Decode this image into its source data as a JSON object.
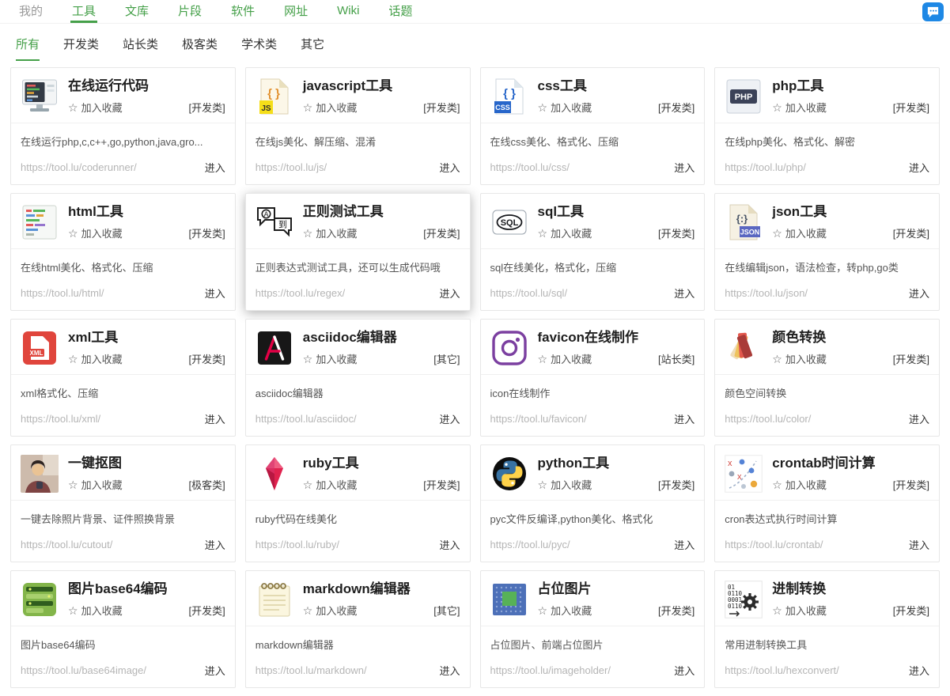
{
  "colors": {
    "accent": "#45a049",
    "chat_icon": "#1e88e5"
  },
  "labels": {
    "favorite": "加入收藏",
    "enter": "进入",
    "star_glyph": "☆"
  },
  "nav": {
    "items": [
      {
        "key": "my",
        "label": "我的",
        "muted": true
      },
      {
        "key": "tools",
        "label": "工具",
        "active": true
      },
      {
        "key": "docs",
        "label": "文库"
      },
      {
        "key": "snippets",
        "label": "片段"
      },
      {
        "key": "software",
        "label": "软件"
      },
      {
        "key": "urls",
        "label": "网址"
      },
      {
        "key": "wiki",
        "label": "Wiki"
      },
      {
        "key": "topics",
        "label": "话题"
      }
    ]
  },
  "tabs": [
    {
      "key": "all",
      "label": "所有",
      "active": true
    },
    {
      "key": "dev",
      "label": "开发类"
    },
    {
      "key": "webmaster",
      "label": "站长类"
    },
    {
      "key": "geek",
      "label": "极客类"
    },
    {
      "key": "academic",
      "label": "学术类"
    },
    {
      "key": "other",
      "label": "其它"
    }
  ],
  "cards": [
    {
      "key": "coderunner",
      "title": "在线运行代码",
      "category": "[开发类]",
      "desc": "在线运行php,c,c++,go,python,java,gro...",
      "url": "https://tool.lu/coderunner/",
      "icon": "coderunner"
    },
    {
      "key": "js",
      "title": "javascript工具",
      "category": "[开发类]",
      "desc": "在线js美化、解压缩、混淆",
      "url": "https://tool.lu/js/",
      "icon": "js",
      "icon_text": "JS"
    },
    {
      "key": "css",
      "title": "css工具",
      "category": "[开发类]",
      "desc": "在线css美化、格式化、压缩",
      "url": "https://tool.lu/css/",
      "icon": "css",
      "icon_text": "CSS"
    },
    {
      "key": "php",
      "title": "php工具",
      "category": "[开发类]",
      "desc": "在线php美化、格式化、解密",
      "url": "https://tool.lu/php/",
      "icon": "php",
      "icon_text": "PHP"
    },
    {
      "key": "html",
      "title": "html工具",
      "category": "[开发类]",
      "desc": "在线html美化、格式化、压缩",
      "url": "https://tool.lu/html/",
      "icon": "html"
    },
    {
      "key": "regex",
      "title": "正则测试工具",
      "category": "[开发类]",
      "desc": "正则表达式测试工具，还可以生成代码哦",
      "url": "https://tool.lu/regex/",
      "icon": "regex",
      "icon_text": "A到",
      "highlighted": true
    },
    {
      "key": "sql",
      "title": "sql工具",
      "category": "[开发类]",
      "desc": "sql在线美化，格式化，压缩",
      "url": "https://tool.lu/sql/",
      "icon": "sql",
      "icon_text": "SQL"
    },
    {
      "key": "json",
      "title": "json工具",
      "category": "[开发类]",
      "desc": "在线编辑json，语法检查，转php,go类",
      "url": "https://tool.lu/json/",
      "icon": "json",
      "icon_text": "JSON"
    },
    {
      "key": "xml",
      "title": "xml工具",
      "category": "[开发类]",
      "desc": "xml格式化、压缩",
      "url": "https://tool.lu/xml/",
      "icon": "xml",
      "icon_text": "XML"
    },
    {
      "key": "asciidoc",
      "title": "asciidoc编辑器",
      "category": "[其它]",
      "desc": "asciidoc编辑器",
      "url": "https://tool.lu/asciidoc/",
      "icon": "asciidoc"
    },
    {
      "key": "favicon",
      "title": "favicon在线制作",
      "category": "[站长类]",
      "desc": "icon在线制作",
      "url": "https://tool.lu/favicon/",
      "icon": "favicon"
    },
    {
      "key": "color",
      "title": "颜色转换",
      "category": "[开发类]",
      "desc": "颜色空间转换",
      "url": "https://tool.lu/color/",
      "icon": "color"
    },
    {
      "key": "cutout",
      "title": "一键抠图",
      "category": "[极客类]",
      "desc": "一键去除照片背景、证件照换背景",
      "url": "https://tool.lu/cutout/",
      "icon": "cutout"
    },
    {
      "key": "ruby",
      "title": "ruby工具",
      "category": "[开发类]",
      "desc": "ruby代码在线美化",
      "url": "https://tool.lu/ruby/",
      "icon": "ruby"
    },
    {
      "key": "pyc",
      "title": "python工具",
      "category": "[开发类]",
      "desc": "pyc文件反编译,python美化、格式化",
      "url": "https://tool.lu/pyc/",
      "icon": "python"
    },
    {
      "key": "crontab",
      "title": "crontab时间计算",
      "category": "[开发类]",
      "desc": "cron表达式执行时间计算",
      "url": "https://tool.lu/crontab/",
      "icon": "crontab"
    },
    {
      "key": "base64image",
      "title": "图片base64编码",
      "category": "[开发类]",
      "desc": "图片base64编码",
      "url": "https://tool.lu/base64image/",
      "icon": "base64image"
    },
    {
      "key": "markdown",
      "title": "markdown编辑器",
      "category": "[其它]",
      "desc": "markdown编辑器",
      "url": "https://tool.lu/markdown/",
      "icon": "markdown"
    },
    {
      "key": "imageholder",
      "title": "占位图片",
      "category": "[开发类]",
      "desc": "占位图片、前端占位图片",
      "url": "https://tool.lu/imageholder/",
      "icon": "imageholder"
    },
    {
      "key": "hexconvert",
      "title": "进制转换",
      "category": "[开发类]",
      "desc": "常用进制转换工具",
      "url": "https://tool.lu/hexconvert/",
      "icon": "hexconvert",
      "icon_text": "01 0110 0001 0110"
    }
  ]
}
